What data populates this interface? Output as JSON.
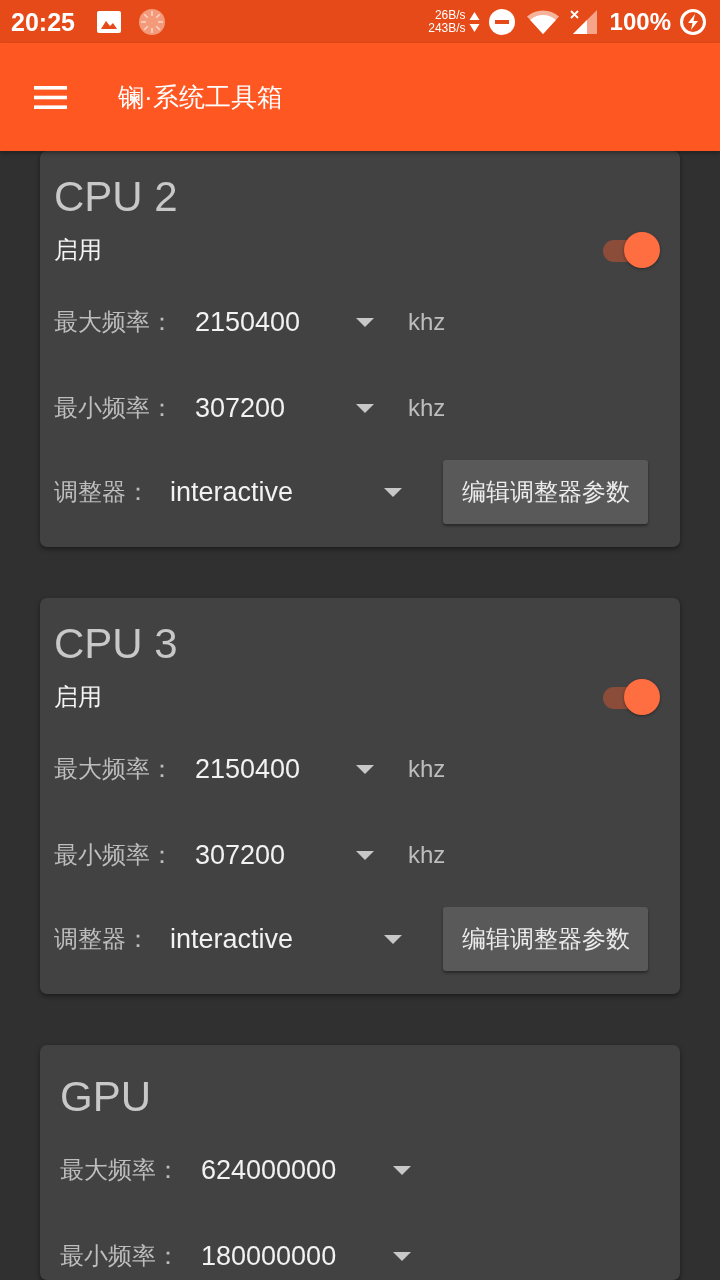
{
  "status_bar": {
    "time": "20:25",
    "upload_speed": "26B/s",
    "download_speed": "243B/s",
    "battery": "100%"
  },
  "app_bar": {
    "title": "镧·系统工具箱"
  },
  "cards": [
    {
      "kind": "cpu",
      "title": "CPU 2",
      "enable": {
        "label": "启用",
        "on": true
      },
      "frequencies": [
        {
          "label": "最大频率：",
          "value": "2150400",
          "unit": "khz"
        },
        {
          "label": "最小频率：",
          "value": "307200",
          "unit": "khz"
        }
      ],
      "governor": {
        "label": "调整器：",
        "value": "interactive",
        "button": "编辑调整器参数"
      }
    },
    {
      "kind": "cpu",
      "title": "CPU 3",
      "enable": {
        "label": "启用",
        "on": true
      },
      "frequencies": [
        {
          "label": "最大频率：",
          "value": "2150400",
          "unit": "khz"
        },
        {
          "label": "最小频率：",
          "value": "307200",
          "unit": "khz"
        }
      ],
      "governor": {
        "label": "调整器：",
        "value": "interactive",
        "button": "编辑调整器参数"
      }
    },
    {
      "kind": "gpu",
      "title": "GPU",
      "frequencies": [
        {
          "label": "最大频率：",
          "value": "624000000"
        },
        {
          "label": "最小频率：",
          "value": "180000000"
        }
      ]
    }
  ]
}
